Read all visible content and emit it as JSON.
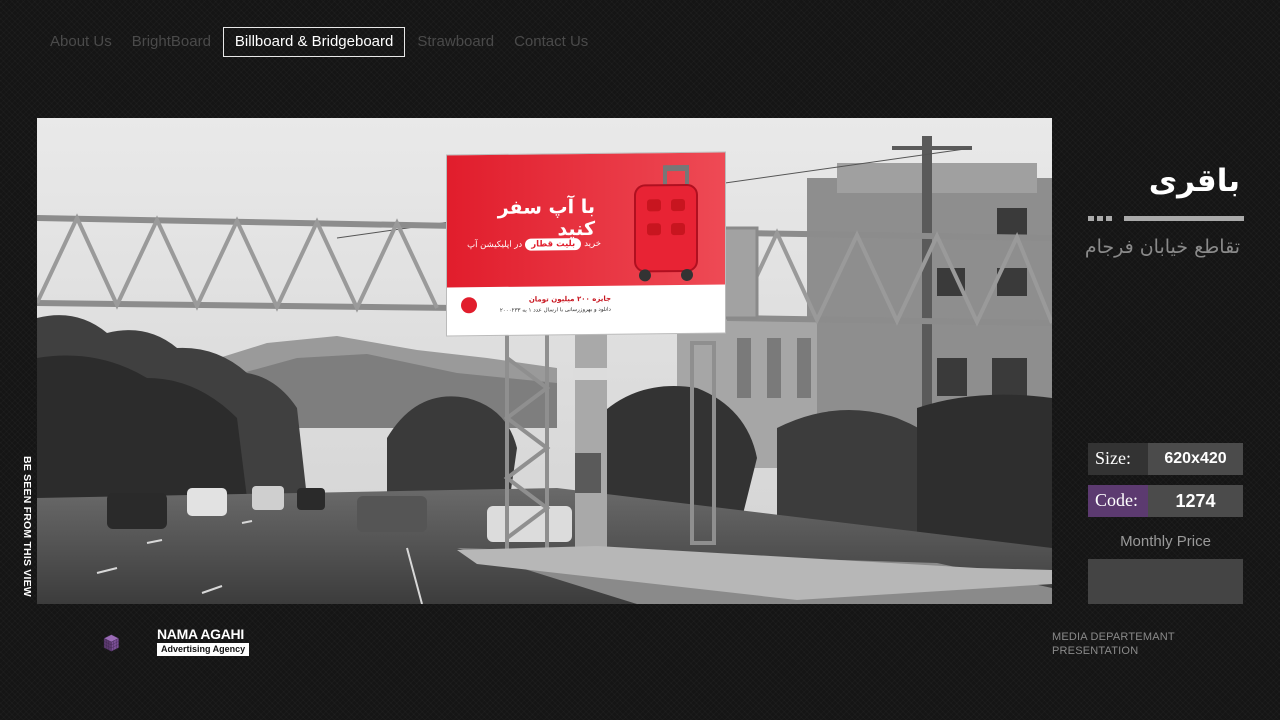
{
  "nav": {
    "items": [
      {
        "label": "About Us",
        "active": false
      },
      {
        "label": "BrightBoard",
        "active": false
      },
      {
        "label": "Billboard & Bridgeboard",
        "active": true
      },
      {
        "label": "Strawboard",
        "active": false
      },
      {
        "label": "Contact Us",
        "active": false
      }
    ]
  },
  "photo": {
    "caption": "BE SEEN FROM THIS VIEW",
    "ad": {
      "headline": "با آپ سفر کنید",
      "subline_prefix": "خرید",
      "subline_badge": "بلیت قطار",
      "subline_suffix": "در اپلیکیشن آپ",
      "prize_line": "جایزه ۲۰۰ میلیون تومان",
      "footer_line": "دانلود و بهروزرسانی با ارسال عدد ۱ به ۲۰۰۰۲۳۳"
    }
  },
  "location": {
    "title": "باقری",
    "subtitle": "تقاطع خیابان فرجام"
  },
  "specs": {
    "size_label": "Size:",
    "size_value": "620x420",
    "code_label": "Code:",
    "code_value": "1274",
    "price_label": "Monthly Price",
    "price_value": ""
  },
  "brand": {
    "name": "NAMA AGAHI",
    "tagline": "Advertising Agency"
  },
  "footer": {
    "line1": "MEDIA DEPARTEMANT",
    "line2": "PRESENTATION"
  },
  "colors": {
    "accent_purple": "#5c3a70",
    "ad_red": "#e01e2d",
    "background": "#151515"
  }
}
